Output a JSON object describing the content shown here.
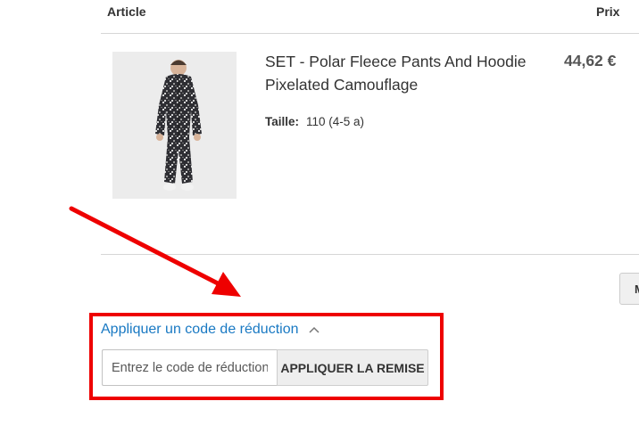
{
  "table": {
    "header_article": "Article",
    "header_price": "Prix"
  },
  "item": {
    "name": "SET - Polar Fleece Pants And Hoodie Pixelated Camouflage",
    "price": "44,62 €",
    "option_label": "Taille:",
    "option_value": "110 (4-5 a)"
  },
  "update_button_label": "M",
  "discount": {
    "toggle_label": "Appliquer un code de réduction",
    "input_placeholder": "Entrez le code de réduction",
    "input_value": "",
    "apply_label": "APPLIQUER LA REMISE"
  },
  "colors": {
    "link": "#1979c3",
    "highlight": "#ee0000",
    "price": "#555555"
  },
  "icons": {
    "toggle": "chevron-up-icon"
  }
}
